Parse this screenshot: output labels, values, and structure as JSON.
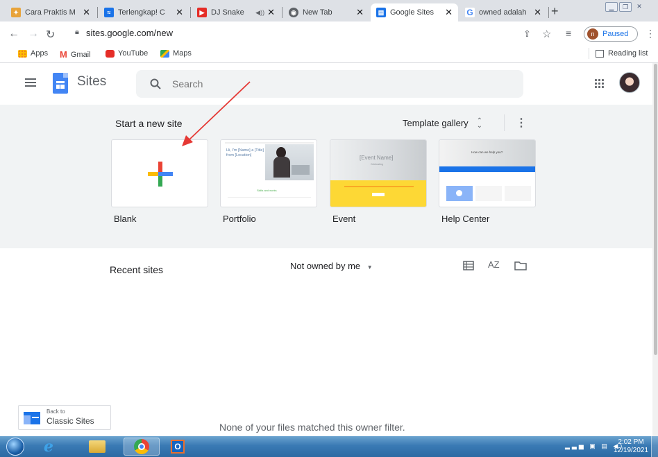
{
  "browser": {
    "tabs": [
      {
        "title": "Cara Praktis M",
        "favicon_color": "#e8a33a"
      },
      {
        "title": "Terlengkap! C",
        "favicon_color": "#1a73e8"
      },
      {
        "title": "DJ Snake",
        "favicon_color": "#e52d27"
      },
      {
        "title": "New Tab",
        "favicon_color": "#5f6368"
      },
      {
        "title": "Google Sites",
        "favicon_color": "#1a73e8"
      },
      {
        "title": "owned adalah",
        "favicon_color": "#4285f4"
      }
    ],
    "address": "sites.google.com/new",
    "profile_status": "Paused",
    "profile_initial": "n",
    "bookmarks": [
      "Apps",
      "Gmail",
      "YouTube",
      "Maps"
    ],
    "reading_list": "Reading list"
  },
  "app": {
    "title": "Sites",
    "search_placeholder": "Search",
    "brand_color": "#1a73e8"
  },
  "templates": {
    "heading": "Start a new site",
    "gallery_label": "Template gallery",
    "items": [
      {
        "label": "Blank"
      },
      {
        "label": "Portfolio",
        "thumb_title": "Hi, I'm [Name] a [Title] from [Location]",
        "thumb_caption": "Skills and works"
      },
      {
        "label": "Event",
        "thumb_title": "[Event Name]",
        "thumb_caption": "Celebrating"
      },
      {
        "label": "Help Center",
        "thumb_title": "How can we help you?"
      }
    ]
  },
  "recent": {
    "heading": "Recent sites",
    "owner_filter": "Not owned by me",
    "sort_label": "AZ",
    "empty_message": "None of your files matched this owner filter."
  },
  "classic": {
    "line1": "Back to",
    "line2": "Classic Sites"
  },
  "taskbar": {
    "time": "2:02 PM",
    "date": "12/19/2021"
  },
  "annotation": {
    "arrow_color": "#e53935"
  }
}
